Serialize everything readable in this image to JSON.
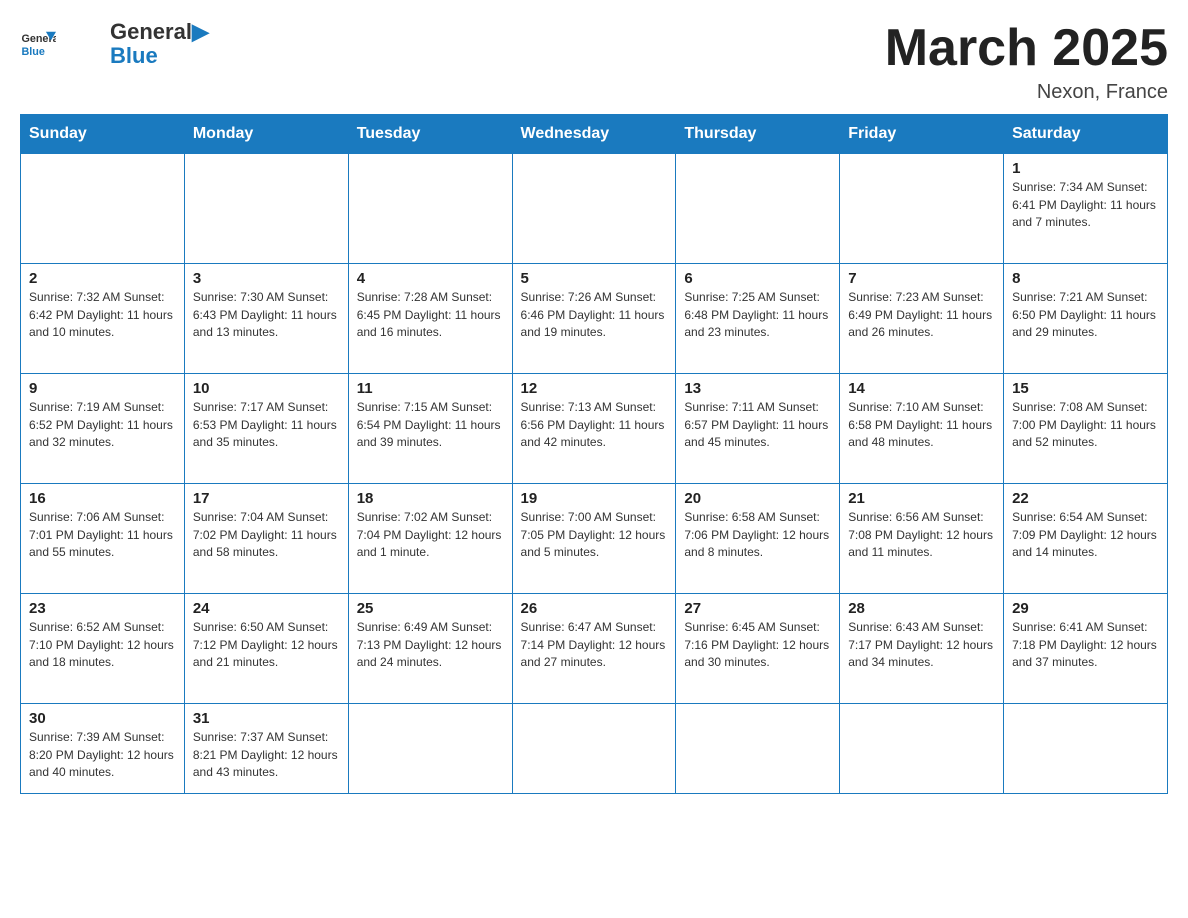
{
  "header": {
    "logo_general": "General",
    "logo_blue": "Blue",
    "title": "March 2025",
    "subtitle": "Nexon, France"
  },
  "days_of_week": [
    "Sunday",
    "Monday",
    "Tuesday",
    "Wednesday",
    "Thursday",
    "Friday",
    "Saturday"
  ],
  "weeks": [
    [
      {
        "day": "",
        "info": ""
      },
      {
        "day": "",
        "info": ""
      },
      {
        "day": "",
        "info": ""
      },
      {
        "day": "",
        "info": ""
      },
      {
        "day": "",
        "info": ""
      },
      {
        "day": "",
        "info": ""
      },
      {
        "day": "1",
        "info": "Sunrise: 7:34 AM\nSunset: 6:41 PM\nDaylight: 11 hours\nand 7 minutes."
      }
    ],
    [
      {
        "day": "2",
        "info": "Sunrise: 7:32 AM\nSunset: 6:42 PM\nDaylight: 11 hours\nand 10 minutes."
      },
      {
        "day": "3",
        "info": "Sunrise: 7:30 AM\nSunset: 6:43 PM\nDaylight: 11 hours\nand 13 minutes."
      },
      {
        "day": "4",
        "info": "Sunrise: 7:28 AM\nSunset: 6:45 PM\nDaylight: 11 hours\nand 16 minutes."
      },
      {
        "day": "5",
        "info": "Sunrise: 7:26 AM\nSunset: 6:46 PM\nDaylight: 11 hours\nand 19 minutes."
      },
      {
        "day": "6",
        "info": "Sunrise: 7:25 AM\nSunset: 6:48 PM\nDaylight: 11 hours\nand 23 minutes."
      },
      {
        "day": "7",
        "info": "Sunrise: 7:23 AM\nSunset: 6:49 PM\nDaylight: 11 hours\nand 26 minutes."
      },
      {
        "day": "8",
        "info": "Sunrise: 7:21 AM\nSunset: 6:50 PM\nDaylight: 11 hours\nand 29 minutes."
      }
    ],
    [
      {
        "day": "9",
        "info": "Sunrise: 7:19 AM\nSunset: 6:52 PM\nDaylight: 11 hours\nand 32 minutes."
      },
      {
        "day": "10",
        "info": "Sunrise: 7:17 AM\nSunset: 6:53 PM\nDaylight: 11 hours\nand 35 minutes."
      },
      {
        "day": "11",
        "info": "Sunrise: 7:15 AM\nSunset: 6:54 PM\nDaylight: 11 hours\nand 39 minutes."
      },
      {
        "day": "12",
        "info": "Sunrise: 7:13 AM\nSunset: 6:56 PM\nDaylight: 11 hours\nand 42 minutes."
      },
      {
        "day": "13",
        "info": "Sunrise: 7:11 AM\nSunset: 6:57 PM\nDaylight: 11 hours\nand 45 minutes."
      },
      {
        "day": "14",
        "info": "Sunrise: 7:10 AM\nSunset: 6:58 PM\nDaylight: 11 hours\nand 48 minutes."
      },
      {
        "day": "15",
        "info": "Sunrise: 7:08 AM\nSunset: 7:00 PM\nDaylight: 11 hours\nand 52 minutes."
      }
    ],
    [
      {
        "day": "16",
        "info": "Sunrise: 7:06 AM\nSunset: 7:01 PM\nDaylight: 11 hours\nand 55 minutes."
      },
      {
        "day": "17",
        "info": "Sunrise: 7:04 AM\nSunset: 7:02 PM\nDaylight: 11 hours\nand 58 minutes."
      },
      {
        "day": "18",
        "info": "Sunrise: 7:02 AM\nSunset: 7:04 PM\nDaylight: 12 hours\nand 1 minute."
      },
      {
        "day": "19",
        "info": "Sunrise: 7:00 AM\nSunset: 7:05 PM\nDaylight: 12 hours\nand 5 minutes."
      },
      {
        "day": "20",
        "info": "Sunrise: 6:58 AM\nSunset: 7:06 PM\nDaylight: 12 hours\nand 8 minutes."
      },
      {
        "day": "21",
        "info": "Sunrise: 6:56 AM\nSunset: 7:08 PM\nDaylight: 12 hours\nand 11 minutes."
      },
      {
        "day": "22",
        "info": "Sunrise: 6:54 AM\nSunset: 7:09 PM\nDaylight: 12 hours\nand 14 minutes."
      }
    ],
    [
      {
        "day": "23",
        "info": "Sunrise: 6:52 AM\nSunset: 7:10 PM\nDaylight: 12 hours\nand 18 minutes."
      },
      {
        "day": "24",
        "info": "Sunrise: 6:50 AM\nSunset: 7:12 PM\nDaylight: 12 hours\nand 21 minutes."
      },
      {
        "day": "25",
        "info": "Sunrise: 6:49 AM\nSunset: 7:13 PM\nDaylight: 12 hours\nand 24 minutes."
      },
      {
        "day": "26",
        "info": "Sunrise: 6:47 AM\nSunset: 7:14 PM\nDaylight: 12 hours\nand 27 minutes."
      },
      {
        "day": "27",
        "info": "Sunrise: 6:45 AM\nSunset: 7:16 PM\nDaylight: 12 hours\nand 30 minutes."
      },
      {
        "day": "28",
        "info": "Sunrise: 6:43 AM\nSunset: 7:17 PM\nDaylight: 12 hours\nand 34 minutes."
      },
      {
        "day": "29",
        "info": "Sunrise: 6:41 AM\nSunset: 7:18 PM\nDaylight: 12 hours\nand 37 minutes."
      }
    ],
    [
      {
        "day": "30",
        "info": "Sunrise: 7:39 AM\nSunset: 8:20 PM\nDaylight: 12 hours\nand 40 minutes."
      },
      {
        "day": "31",
        "info": "Sunrise: 7:37 AM\nSunset: 8:21 PM\nDaylight: 12 hours\nand 43 minutes."
      },
      {
        "day": "",
        "info": ""
      },
      {
        "day": "",
        "info": ""
      },
      {
        "day": "",
        "info": ""
      },
      {
        "day": "",
        "info": ""
      },
      {
        "day": "",
        "info": ""
      }
    ]
  ]
}
